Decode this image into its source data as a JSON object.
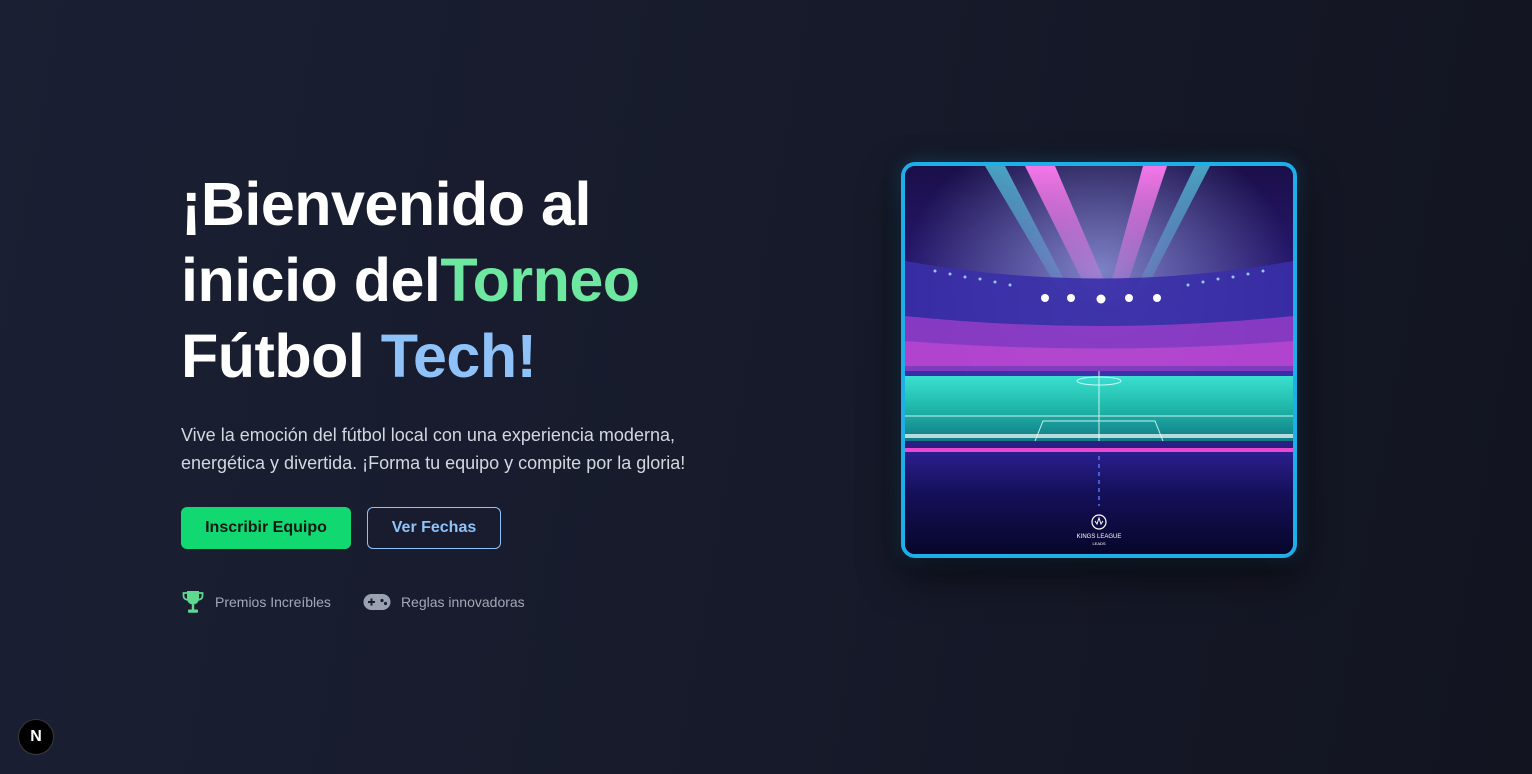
{
  "hero": {
    "title_line1": "¡Bienvenido al",
    "title_line2_prefix": "inicio del",
    "title_line2_accent": "Torneo",
    "title_line3_prefix": "Fútbol ",
    "title_line3_accent": "Tech!",
    "subtitle_line1": "Vive la emoción del fútbol local con una experiencia moderna,",
    "subtitle_line2": "energética y divertida. ¡Forma tu equipo y compite por la gloria!"
  },
  "cta": {
    "primary_label": "Inscribir Equipo",
    "secondary_label": "Ver Fechas"
  },
  "features": [
    {
      "icon": "trophy-icon",
      "label": "Premios Increíbles"
    },
    {
      "icon": "gamepad-icon",
      "label": "Reglas innovadoras"
    }
  ],
  "image": {
    "logo_text_line1": "KINGS LEAGUE",
    "logo_text_line2": "LEADS"
  },
  "badge": {
    "label": "N"
  },
  "colors": {
    "background": "#171b2c",
    "accent_green": "#6ee7a1",
    "accent_blue": "#8ec2f8",
    "primary_button": "#12d872",
    "image_border": "#1eaee8"
  }
}
